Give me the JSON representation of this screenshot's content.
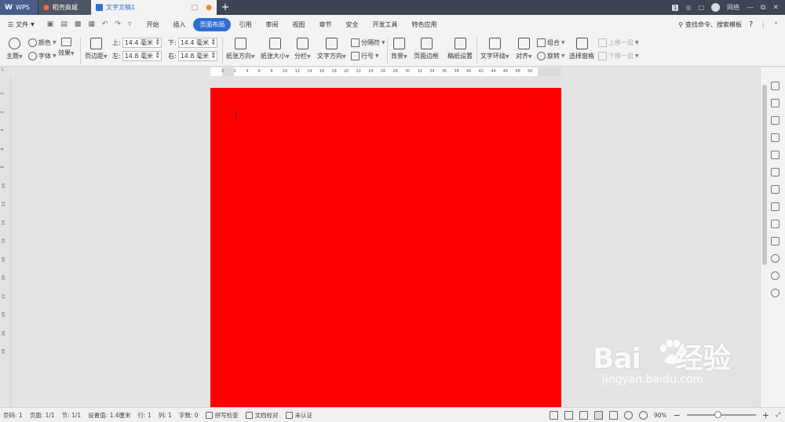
{
  "titlebar": {
    "tabs": [
      {
        "label": "WPS"
      },
      {
        "label": "稻壳商城"
      },
      {
        "label": "文字文稿1"
      }
    ],
    "badge": "1",
    "user": "网络"
  },
  "menubar": {
    "file": "文件",
    "items": [
      "开始",
      "插入",
      "页面布局",
      "引用",
      "审阅",
      "视图",
      "章节",
      "安全",
      "开发工具",
      "特色应用"
    ],
    "active_index": 2,
    "search": "查找命令、搜索模板"
  },
  "ribbon": {
    "theme": "主题",
    "colors": "颜色",
    "font": "字体",
    "effects": "效果",
    "margins": "页边距",
    "top_label": "上:",
    "top_value": "14.4 毫米",
    "bottom_label": "下:",
    "bottom_value": "14.4 毫米",
    "left_label": "左:",
    "left_value": "14.8 毫米",
    "right_label": "右:",
    "right_value": "14.8 毫米",
    "orientation": "纸张方向",
    "size": "纸张大小",
    "columns": "分栏",
    "text_direction": "文字方向",
    "breaks": "分隔符",
    "line_numbers": "行号",
    "background": "背景",
    "page_border": "页面边框",
    "manuscript": "稿纸设置",
    "wrap_text": "文字环绕",
    "align": "对齐",
    "group": "组合",
    "rotate": "旋转",
    "selection_pane": "选择窗格",
    "bring_forward": "上移一层",
    "send_backward": "下移一层"
  },
  "ruler": {
    "ticks": [
      "2",
      "2",
      "4",
      "6",
      "8",
      "10",
      "12",
      "14",
      "16",
      "18",
      "20",
      "22",
      "24",
      "26",
      "28",
      "30",
      "32",
      "34",
      "36",
      "38",
      "40",
      "42",
      "44",
      "46",
      "48",
      "50"
    ],
    "vticks": [
      "2",
      "2",
      "4",
      "6",
      "8",
      "10",
      "12",
      "14",
      "16",
      "18",
      "20",
      "22",
      "24",
      "26",
      "28"
    ]
  },
  "document": {
    "page_color": "#ff0000"
  },
  "statusbar": {
    "page_num": "页码: 1",
    "pages": "页面: 1/1",
    "section": "节: 1/1",
    "position": "设置值: 1.4厘米",
    "row": "行: 1",
    "col": "列: 1",
    "word_count": "字数: 0",
    "spell_check": "拼写检查",
    "doc_proof": "文档校对",
    "unverified": "未认证",
    "zoom": "90%",
    "zoom_level": 0.45
  },
  "watermark": {
    "brand": "Bai",
    "brand_cn": "经验",
    "url": "jingyan.baidu.com"
  }
}
